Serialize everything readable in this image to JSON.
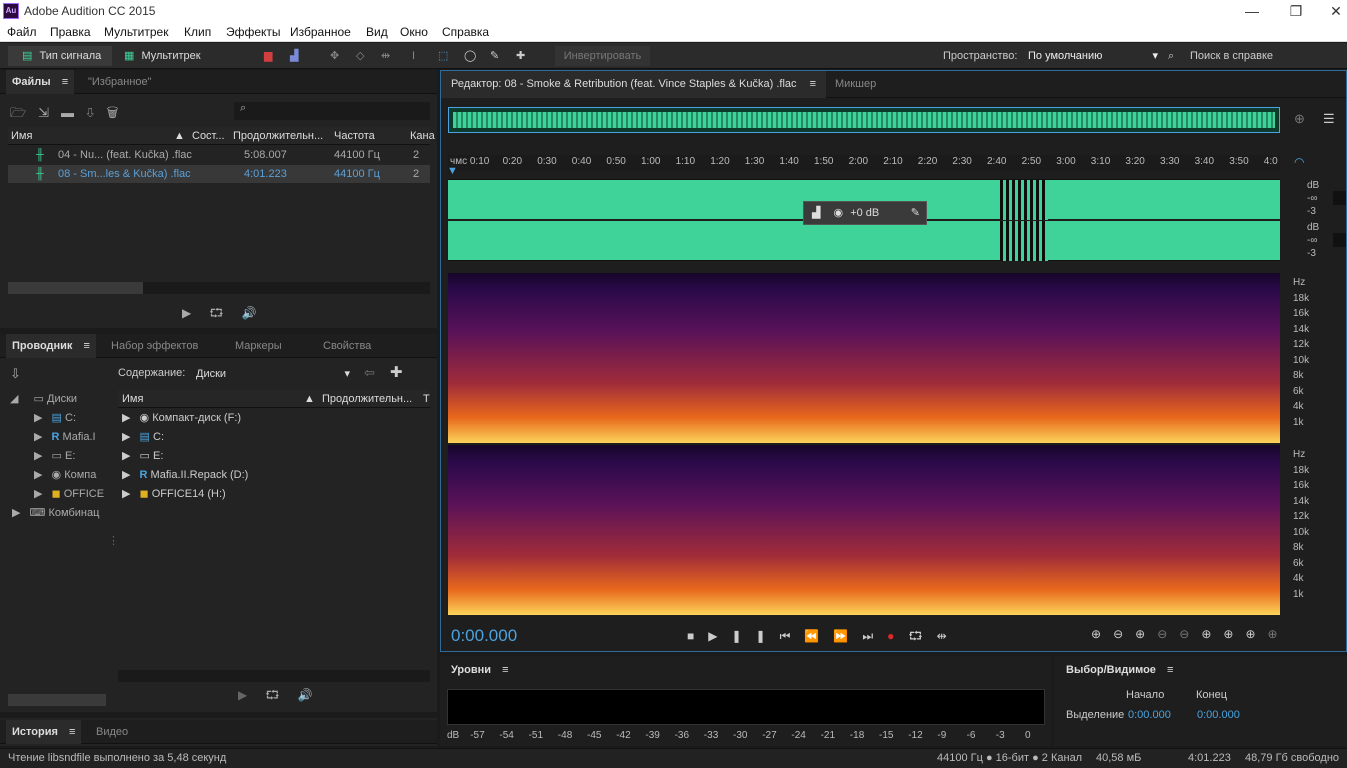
{
  "app": {
    "title": "Adobe Audition CC 2015",
    "logo": "Au"
  },
  "menu": [
    "Файл",
    "Правка",
    "Мультитрек",
    "Клип",
    "Эффекты",
    "Избранное",
    "Вид",
    "Окно",
    "Справка"
  ],
  "toolbar": {
    "waveform_mode": "Тип сигнала",
    "multitrack_mode": "Мультитрек",
    "invert_label": "Инвертировать",
    "workspace_label": "Пространство:",
    "workspace_value": "По умолчанию",
    "help_search_placeholder": "Поиск в справке"
  },
  "files_panel": {
    "tabs": [
      "Файлы",
      "\"Избранное\""
    ],
    "columns": [
      "Имя",
      "Сост...",
      "Продолжительн...",
      "Частота",
      "Кана"
    ],
    "rows": [
      {
        "name": "04 - Nu... (feat. Kučka) .flac",
        "duration": "5:08.007",
        "rate": "44100 Гц",
        "channels": "2"
      },
      {
        "name": "08 - Sm...les & Kučka) .flac",
        "duration": "4:01.223",
        "rate": "44100 Гц",
        "channels": "2"
      }
    ]
  },
  "explorer_panel": {
    "tabs": [
      "Проводник",
      "Набор эффектов",
      "Маркеры",
      "Свойства"
    ],
    "content_label": "Содержание:",
    "content_value": "Диски",
    "tree": [
      "Диски",
      "C:",
      "Mafia.I",
      "E:",
      "Компа",
      "OFFICE",
      "Комбинац"
    ],
    "columns": [
      "Имя",
      "Продолжительн...",
      "Т"
    ],
    "items": [
      "Компакт-диск (F:)",
      "C:",
      "E:",
      "Mafia.II.Repack (D:)",
      "OFFICE14 (H:)"
    ]
  },
  "history_panel": {
    "tabs": [
      "История",
      "Видео"
    ]
  },
  "editor": {
    "tab_title": "Редактор: 08 - Smoke & Retribution (feat. Vince Staples & Kučka) .flac",
    "mixer_tab": "Микшер",
    "ruler": [
      "чмс 0:10",
      "0:20",
      "0:30",
      "0:40",
      "0:50",
      "1:00",
      "1:10",
      "1:20",
      "1:30",
      "1:40",
      "1:50",
      "2:00",
      "2:10",
      "2:20",
      "2:30",
      "2:40",
      "2:50",
      "3:00",
      "3:10",
      "3:20",
      "3:30",
      "3:40",
      "3:50",
      "4:0"
    ],
    "hud_gain": "+0 dB",
    "db_scale": [
      "dB",
      "-∞",
      "-3"
    ],
    "hz_scale": [
      "Hz",
      "18k",
      "16k",
      "14k",
      "12k",
      "10k",
      "8k",
      "6k",
      "4k",
      "1k"
    ],
    "time": "0:00.000"
  },
  "levels_panel": {
    "title": "Уровни",
    "scale": [
      "dB",
      "-57",
      "-54",
      "-51",
      "-48",
      "-45",
      "-42",
      "-39",
      "-36",
      "-33",
      "-30",
      "-27",
      "-24",
      "-21",
      "-18",
      "-15",
      "-12",
      "-9",
      "-6",
      "-3",
      "0"
    ]
  },
  "selection_panel": {
    "title": "Выбор/Видимое",
    "start_label": "Начало",
    "end_label": "Конец",
    "row_label": "Выделение",
    "start_value": "0:00.000",
    "end_value": "0:00.000"
  },
  "status": {
    "message": "Чтение libsndfile выполнено за 5,48 секунд",
    "format": "44100 Гц ● 16-бит ● 2 Канал",
    "size": "40,58 мБ",
    "duration": "4:01.223",
    "free": "48,79 Гб свободно"
  },
  "colors": {
    "accent": "#4aa3df",
    "waveform": "#3fd39a",
    "record": "#e02828"
  }
}
